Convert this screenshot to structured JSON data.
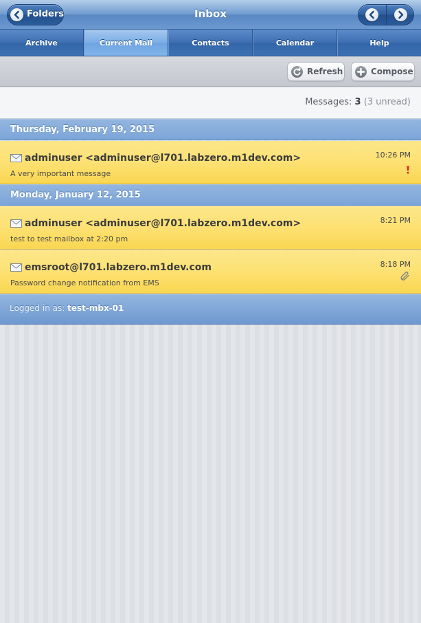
{
  "header": {
    "title": "Inbox",
    "folders_label": "Folders"
  },
  "tabs": [
    {
      "label": "Archive",
      "active": false
    },
    {
      "label": "Current Mail",
      "active": true
    },
    {
      "label": "Contacts",
      "active": false
    },
    {
      "label": "Calendar",
      "active": false
    },
    {
      "label": "Help",
      "active": false
    }
  ],
  "toolbar": {
    "refresh_label": "Refresh",
    "compose_label": "Compose"
  },
  "info": {
    "messages_label": "Messages:",
    "count": "3",
    "unread": "(3 unread)"
  },
  "groups": [
    {
      "date": "Thursday, February 19, 2015",
      "messages": [
        {
          "from": "adminuser <adminuser@l701.labzero.m1dev.com>",
          "subject": "A very important message",
          "time": "10:26 PM",
          "flag": "important-icon"
        }
      ]
    },
    {
      "date": "Monday, January 12, 2015",
      "messages": [
        {
          "from": "adminuser <adminuser@l701.labzero.m1dev.com>",
          "subject": "test to test mailbox at 2:20 pm",
          "time": "8:21 PM",
          "flag": ""
        },
        {
          "from": "emsroot@l701.labzero.m1dev.com",
          "subject": "Password change notification from EMS",
          "time": "8:18 PM",
          "flag": "attachment-icon"
        }
      ]
    }
  ],
  "footer": {
    "logged_in_label": "Logged in as:",
    "user": "test-mbx-01"
  },
  "colors": {
    "header_blue": "#5a88c3",
    "active_tab": "#7caee6",
    "message_yellow": "#fde173",
    "date_header": "#7ca5d7"
  }
}
